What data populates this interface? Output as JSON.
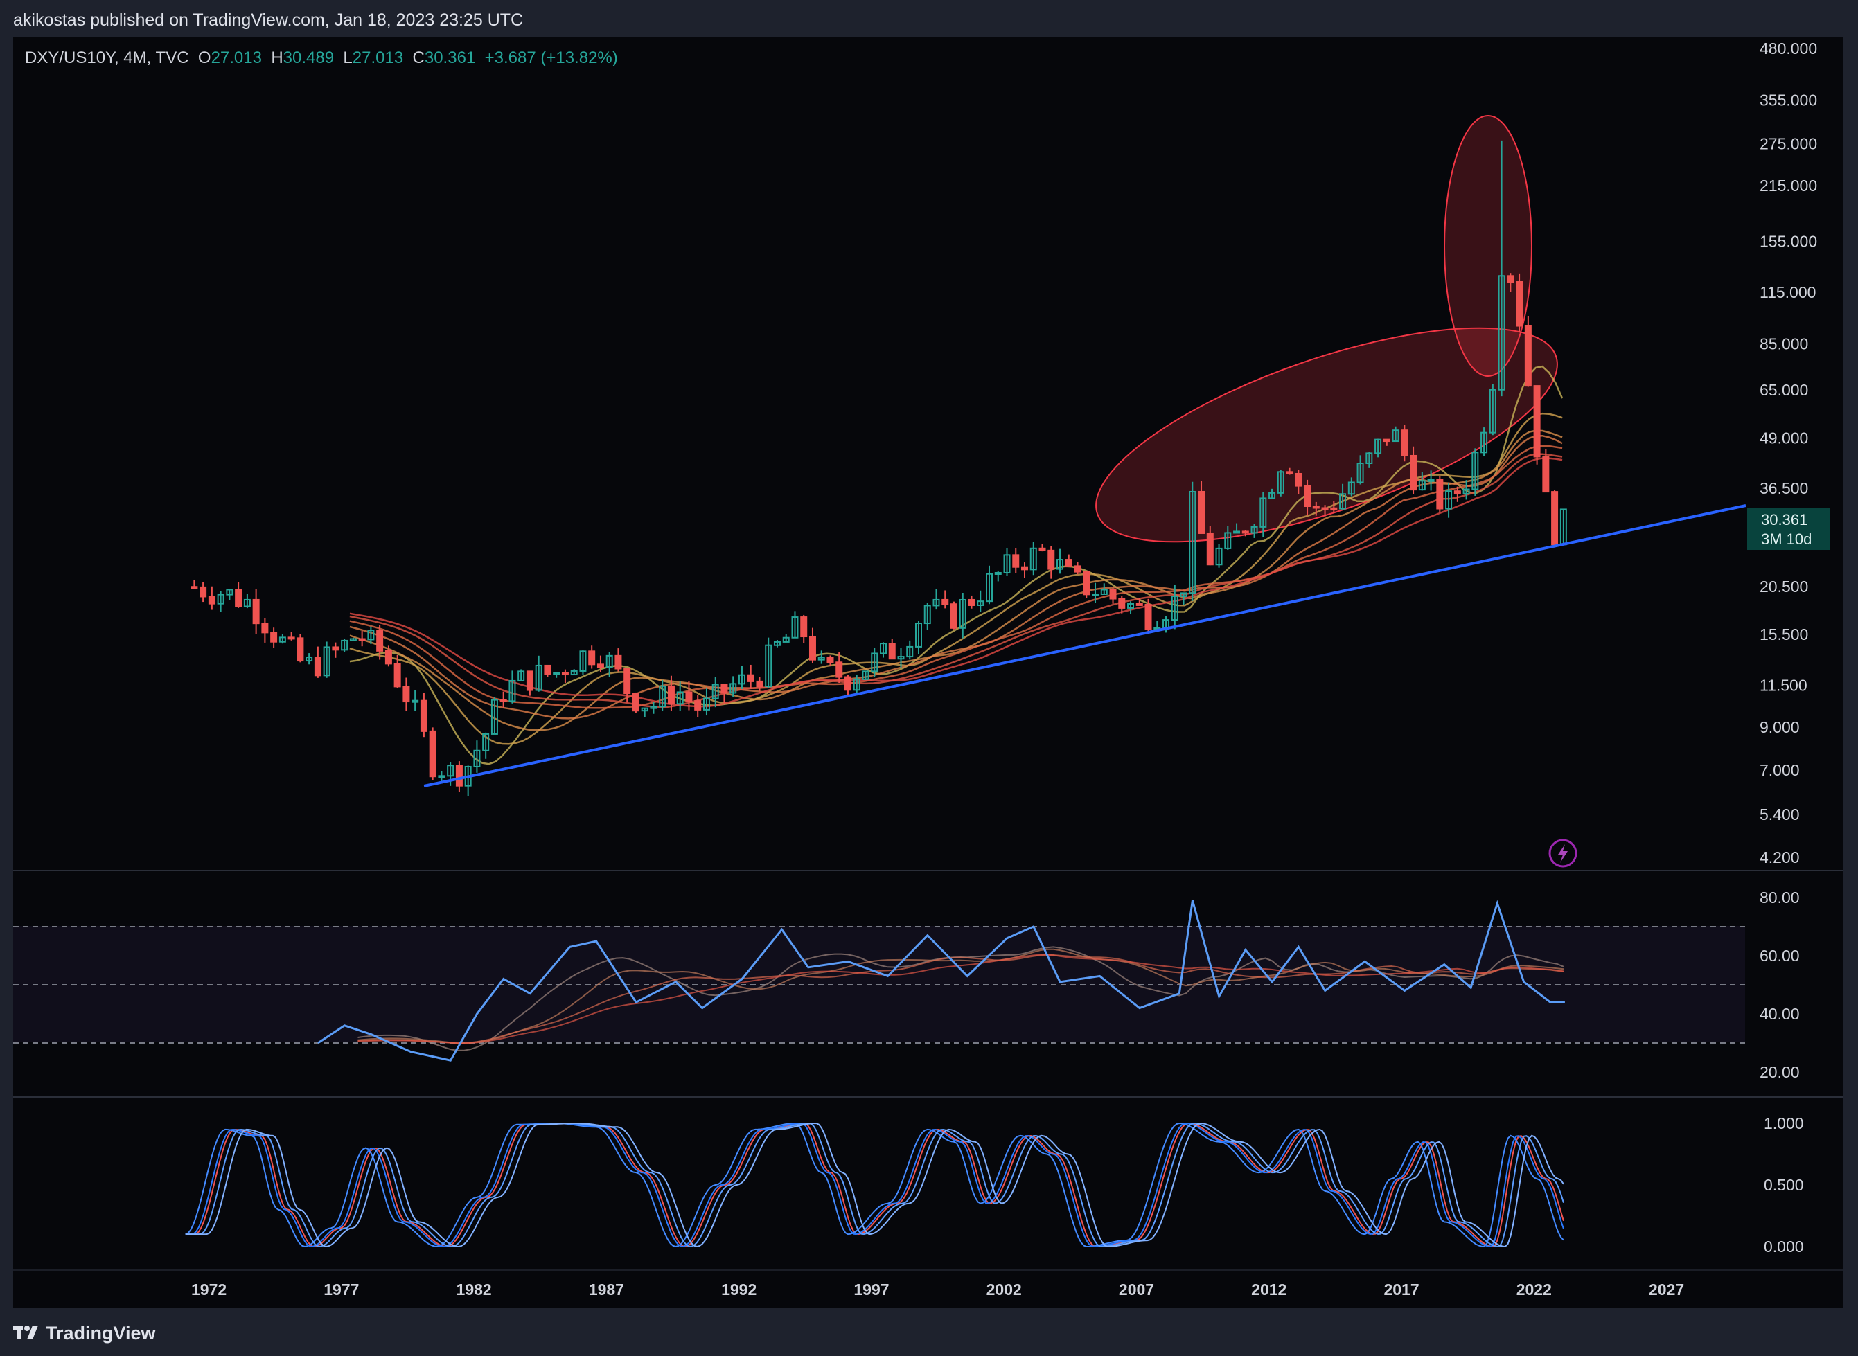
{
  "header": {
    "publisher_line": "akikostas published on TradingView.com, Jan 18, 2023 23:25 UTC"
  },
  "legend": {
    "symbol": "DXY/US10Y, 4M, TVC",
    "o_label": "O",
    "o_value": "27.013",
    "h_label": "H",
    "h_value": "30.489",
    "l_label": "L",
    "l_value": "27.013",
    "c_label": "C",
    "c_value": "30.361",
    "change": "+3.687 (+13.82%)"
  },
  "price_badge": {
    "value": "30.361",
    "countdown": "3M 10d"
  },
  "footer": {
    "brand": "TradingView"
  },
  "colors": {
    "up": "#26a69a",
    "down": "#ef5350",
    "trendline": "#2962ff",
    "rsi": "#5b9cf6",
    "ellipse": "#f23645",
    "background": "#06070b"
  },
  "chart_data": [
    {
      "type": "candlestick",
      "panel": "price",
      "scale": "log",
      "x_axis_labels": [
        "1972",
        "1977",
        "1982",
        "1987",
        "1992",
        "1997",
        "2002",
        "2007",
        "2012",
        "2017",
        "2022",
        "2027"
      ],
      "y_axis_labels": [
        "480.000",
        "355.000",
        "275.000",
        "215.000",
        "155.000",
        "115.000",
        "85.000",
        "65.000",
        "49.000",
        "36.500",
        "20.500",
        "15.500",
        "11.500",
        "9.000",
        "7.000",
        "5.400",
        "4.200"
      ],
      "ylim": [
        4.2,
        480
      ],
      "close_series": [
        [
          1971.3,
          20.5
        ],
        [
          1972.5,
          19.8
        ],
        [
          1973.5,
          18.6
        ],
        [
          1974.5,
          15.2
        ],
        [
          1975.5,
          12.8
        ],
        [
          1976.5,
          13.6
        ],
        [
          1977.5,
          15.6
        ],
        [
          1978.5,
          13.8
        ],
        [
          1979.5,
          10.4
        ],
        [
          1980.3,
          7.4
        ],
        [
          1981.0,
          6.9
        ],
        [
          1981.6,
          7.1
        ],
        [
          1982.3,
          8.6
        ],
        [
          1983.0,
          11.2
        ],
        [
          1984.0,
          12.1
        ],
        [
          1985.0,
          12.4
        ],
        [
          1985.8,
          13.6
        ],
        [
          1986.6,
          14.2
        ],
        [
          1987.2,
          12.6
        ],
        [
          1987.8,
          10.9
        ],
        [
          1988.6,
          10.2
        ],
        [
          1989.5,
          11.3
        ],
        [
          1990.5,
          9.9
        ],
        [
          1991.5,
          11.4
        ],
        [
          1992.5,
          12.0
        ],
        [
          1993.4,
          14.6
        ],
        [
          1994.2,
          16.3
        ],
        [
          1995.0,
          12.6
        ],
        [
          1996.0,
          12.1
        ],
        [
          1997.0,
          13.3
        ],
        [
          1998.0,
          14.6
        ],
        [
          1999.0,
          18.4
        ],
        [
          1999.8,
          16.9
        ],
        [
          2000.6,
          19.0
        ],
        [
          2001.5,
          21.5
        ],
        [
          2002.5,
          24.2
        ],
        [
          2003.5,
          25.0
        ],
        [
          2004.5,
          21.1
        ],
        [
          2005.5,
          20.0
        ],
        [
          2006.5,
          18.5
        ],
        [
          2007.5,
          17.4
        ],
        [
          2008.6,
          19.3
        ],
        [
          2009.0,
          33.0
        ],
        [
          2009.6,
          24.0
        ],
        [
          2010.5,
          26.5
        ],
        [
          2011.6,
          33.5
        ],
        [
          2012.5,
          45.5
        ],
        [
          2013.5,
          31.0
        ],
        [
          2014.5,
          34.5
        ],
        [
          2015.5,
          41.5
        ],
        [
          2016.5,
          52.0
        ],
        [
          2017.5,
          37.5
        ],
        [
          2018.6,
          33.0
        ],
        [
          2019.5,
          40.0
        ],
        [
          2020.3,
          66.0
        ],
        [
          2020.7,
          150.0
        ],
        [
          2021.2,
          115.0
        ],
        [
          2021.8,
          58.0
        ],
        [
          2022.3,
          34.0
        ],
        [
          2022.8,
          27.0
        ],
        [
          2023.05,
          30.361
        ]
      ]
    },
    {
      "type": "line",
      "panel": "rsi",
      "y_axis_labels": [
        "80.00",
        "60.00",
        "40.00",
        "20.00"
      ],
      "ylim": [
        15,
        85
      ],
      "guides": [
        70,
        50,
        30
      ],
      "x": [
        1976.0,
        1977.0,
        1978.0,
        1979.5,
        1981.0,
        1982.0,
        1983.0,
        1984.0,
        1985.5,
        1986.5,
        1988.0,
        1989.5,
        1990.5,
        1992.0,
        1993.5,
        1994.5,
        1996.0,
        1997.5,
        1999.0,
        2000.5,
        2002.0,
        2003.0,
        2004.0,
        2005.5,
        2007.0,
        2008.5,
        2009.0,
        2010.0,
        2011.0,
        2012.0,
        2013.0,
        2014.0,
        2015.5,
        2017.0,
        2018.5,
        2019.5,
        2020.5,
        2021.5,
        2022.5,
        2023.05
      ],
      "values": [
        30,
        36,
        33,
        27,
        24,
        40,
        52,
        47,
        63,
        65,
        44,
        51,
        42,
        52,
        69,
        56,
        58,
        53,
        67,
        53,
        66,
        70,
        51,
        53,
        42,
        47,
        79,
        46,
        62,
        51,
        63,
        48,
        58,
        48,
        57,
        49,
        78,
        51,
        44,
        44
      ]
    },
    {
      "type": "line",
      "panel": "stochastic",
      "y_axis_labels": [
        "1.000",
        "0.500",
        "0.000"
      ],
      "ylim": [
        -0.1,
        1.1
      ],
      "x": [
        1971.0,
        1972.5,
        1973.5,
        1974.5,
        1975.5,
        1976.5,
        1977.8,
        1979.0,
        1980.5,
        1982.0,
        1983.5,
        1985.0,
        1986.5,
        1988.0,
        1989.5,
        1991.0,
        1992.5,
        1994.0,
        1995.0,
        1996.0,
        1997.5,
        1999.0,
        2000.0,
        2001.0,
        2002.5,
        2003.5,
        2005.0,
        2006.5,
        2008.5,
        2010.0,
        2011.5,
        2013.0,
        2014.0,
        2015.5,
        2016.5,
        2017.5,
        2018.5,
        2020.0,
        2021.0,
        2022.0,
        2023.05
      ],
      "values": [
        0.1,
        0.95,
        0.9,
        0.3,
        0.0,
        0.15,
        0.8,
        0.2,
        0.0,
        0.4,
        0.99,
        1.0,
        0.97,
        0.6,
        0.0,
        0.5,
        0.95,
        1.0,
        0.6,
        0.1,
        0.35,
        0.95,
        0.85,
        0.35,
        0.9,
        0.75,
        0.0,
        0.05,
        1.0,
        0.85,
        0.6,
        0.95,
        0.45,
        0.1,
        0.55,
        0.85,
        0.2,
        0.0,
        0.9,
        0.55,
        0.05
      ]
    }
  ]
}
